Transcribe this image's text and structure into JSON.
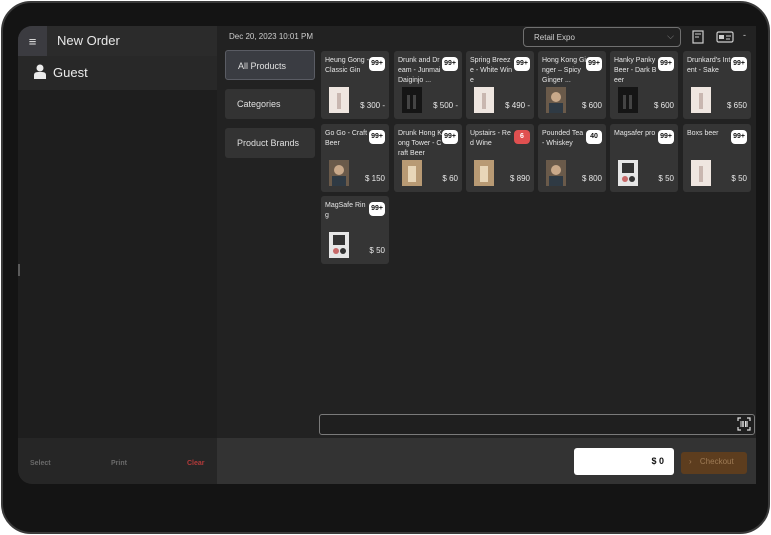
{
  "header": {
    "menu_icon": "hamburger-icon",
    "order_title": "New Order",
    "datetime": "Dec 20, 2023 10:01 PM"
  },
  "customer": {
    "label": "Guest",
    "icon": "person-icon"
  },
  "footer": {
    "select": "Select",
    "print": "Print",
    "clear": "Clear"
  },
  "store": {
    "selected": "Retail Expo"
  },
  "top_icons": {
    "receipt": "receipt-icon",
    "card": "card-icon",
    "extra": "-"
  },
  "categories": [
    {
      "label": "All Products",
      "active": true
    },
    {
      "label": "Categories",
      "active": false
    },
    {
      "label": "Product Brands",
      "active": false
    }
  ],
  "products": [
    {
      "name": "Heung Gong - Classic Gin",
      "badge": "99+",
      "price": "$ 300 -",
      "thumb": "light"
    },
    {
      "name": "Drunk and Dream - Junmai Daiginjo ...",
      "badge": "99+",
      "price": "$ 500 -",
      "thumb": "dark"
    },
    {
      "name": "Spring Breeze - White Wine",
      "badge": "99+",
      "price": "$ 490 -",
      "thumb": "light"
    },
    {
      "name": "Hong Kong Ginger – Spicy Ginger ...",
      "badge": "99+",
      "price": "$ 600",
      "thumb": "photo"
    },
    {
      "name": "Hanky Panky Beer - Dark Beer",
      "badge": "99+",
      "price": "$ 600",
      "thumb": "dark"
    },
    {
      "name": "Drunkard's Intent - Sake",
      "badge": "99+",
      "price": "$ 650",
      "thumb": "light"
    },
    {
      "name": "Go Go - Craft Beer",
      "badge": "99+",
      "price": "$ 150",
      "thumb": "photo"
    },
    {
      "name": "Drunk Hong Kong Tower - Craft Beer",
      "badge": "99+",
      "price": "$ 60",
      "thumb": "tan"
    },
    {
      "name": "Upstairs - Red Wine",
      "badge": "6",
      "badge_red": true,
      "price": "$ 890",
      "thumb": "tan"
    },
    {
      "name": "Pounded Tea - Whiskey",
      "badge": "40",
      "price": "$ 800",
      "thumb": "photo"
    },
    {
      "name": "Magsafer pro",
      "badge": "99+",
      "price": "$ 50",
      "thumb": "device"
    },
    {
      "name": "Boxs beer",
      "badge": "99+",
      "price": "$ 50",
      "thumb": "light"
    },
    {
      "name": "MagSafe Ring",
      "badge": "99+",
      "price": "$ 50",
      "thumb": "device"
    }
  ],
  "scan": {
    "icon": "barcode-scan-icon"
  },
  "checkout": {
    "total": "$ 0",
    "label": "Checkout",
    "icon": "chevron-right-icon"
  },
  "colors": {
    "accent": "#5d3d1e",
    "clear": "#b33a3a",
    "badge_alert": "#e05050"
  }
}
